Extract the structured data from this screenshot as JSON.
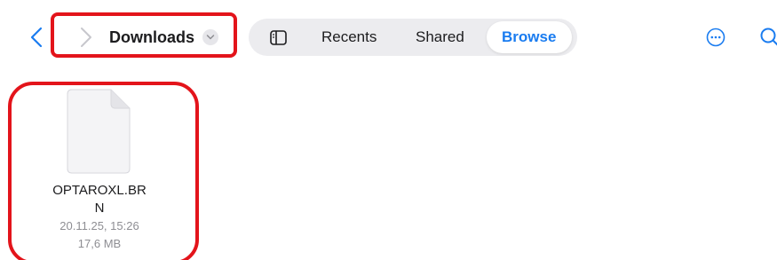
{
  "colors": {
    "accent": "#1a7cf0",
    "annotation": "#e3141b",
    "text": "#1c1c1e",
    "secondary_text": "#8e8e93",
    "tabbar_bg": "#ececef"
  },
  "navigation": {
    "back_icon": "chevron-left-icon",
    "forward_icon": "chevron-right-icon",
    "location_title": "Downloads",
    "location_menu_icon": "chevron-down-icon"
  },
  "tabbar": {
    "sidebar_icon": "sidebar-icon",
    "tabs": [
      {
        "label": "Recents",
        "selected": false
      },
      {
        "label": "Shared",
        "selected": false
      },
      {
        "label": "Browse",
        "selected": true
      }
    ]
  },
  "toolbar": {
    "more_icon": "ellipsis-circle-icon",
    "search_icon": "search-icon"
  },
  "files": [
    {
      "name_line1": "OPTAROXL.BR",
      "name_line2": "N",
      "date": "20.11.25, 15:26",
      "size": "17,6 MB",
      "icon": "document-icon"
    }
  ]
}
